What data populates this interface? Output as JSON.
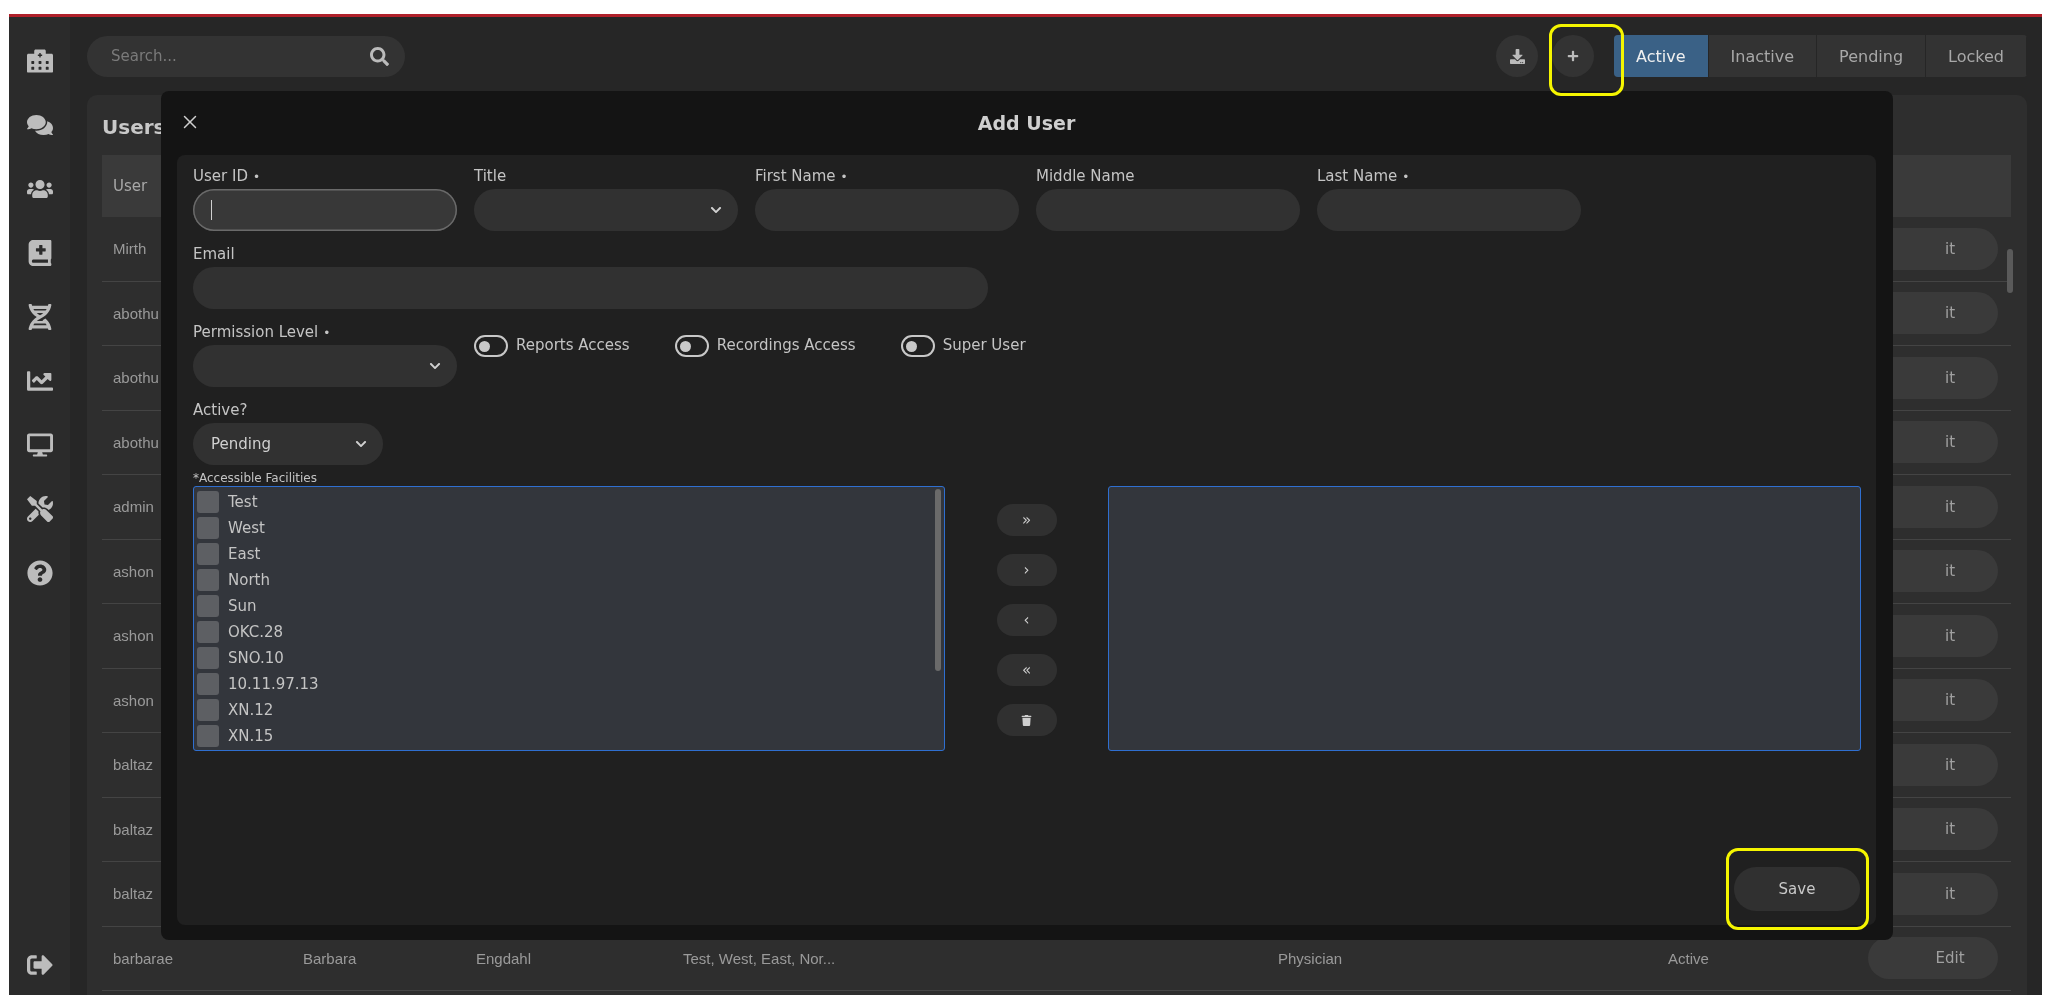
{
  "sidebar": {
    "items": [
      {
        "selected": false
      },
      {
        "selected": false
      },
      {
        "selected": false
      },
      {
        "selected": false
      },
      {
        "selected": false
      },
      {
        "selected": false
      },
      {
        "selected": false
      },
      {
        "selected": false
      },
      {
        "selected": false
      }
    ]
  },
  "topbar": {
    "search": {
      "placeholder": "Search..."
    },
    "status_tabs": [
      {
        "label": "Active",
        "selected": true
      },
      {
        "label": "Inactive",
        "selected": false
      },
      {
        "label": "Pending",
        "selected": false
      },
      {
        "label": "Locked",
        "selected": false
      }
    ]
  },
  "users_panel": {
    "title": "Users",
    "header": "User",
    "rows": [
      {
        "user": "Mirth",
        "edit": "it"
      },
      {
        "user": "abothu",
        "edit": "it"
      },
      {
        "user": "abothu",
        "edit": "it"
      },
      {
        "user": "abothu",
        "edit": "it"
      },
      {
        "user": "admin",
        "edit": "it"
      },
      {
        "user": "ashon",
        "edit": "it"
      },
      {
        "user": "ashon",
        "edit": "it"
      },
      {
        "user": "ashon",
        "edit": "it"
      },
      {
        "user": "baltaz",
        "edit": "it"
      },
      {
        "user": "baltaz",
        "edit": "it"
      },
      {
        "user": "baltaz",
        "edit": "it"
      },
      {
        "user": "barbarae",
        "first": "Barbara",
        "last": "Engdahl",
        "facilities": "Test, West, East, Nor...",
        "title": "Physician",
        "status": "Active",
        "edit": "Edit"
      }
    ]
  },
  "dialog": {
    "title": "Add User",
    "fields": [
      {
        "label": "User ID",
        "required_mark": "•",
        "kind": "text",
        "focused": true
      },
      {
        "label": "Title",
        "kind": "select"
      },
      {
        "label": "First Name",
        "required_mark": "•",
        "kind": "text",
        "focused": false
      },
      {
        "label": "Middle Name",
        "kind": "text",
        "focused": false
      },
      {
        "label": "Last Name",
        "required_mark": "•",
        "kind": "text",
        "focused": false
      }
    ],
    "email": {
      "label": "Email"
    },
    "permission": {
      "label": "Permission Level",
      "required_mark": "•"
    },
    "toggles": [
      {
        "label": "Reports Access",
        "on": false
      },
      {
        "label": "Recordings Access",
        "on": false
      },
      {
        "label": "Super User",
        "on": false
      }
    ],
    "active": {
      "label": "Active?",
      "value": "Pending"
    },
    "facilities": {
      "label": "*Accessible Facilities",
      "available": [
        {
          "name": "Test",
          "checked": false
        },
        {
          "name": "West",
          "checked": false
        },
        {
          "name": "East",
          "checked": false
        },
        {
          "name": "North",
          "checked": false
        },
        {
          "name": "Sun",
          "checked": false
        },
        {
          "name": "OKC.28",
          "checked": false
        },
        {
          "name": "SNO.10",
          "checked": false
        },
        {
          "name": "10.11.97.13",
          "checked": false
        },
        {
          "name": "XN.12",
          "checked": false
        },
        {
          "name": "XN.15",
          "checked": false
        }
      ],
      "transfer_buttons": [
        {
          "kind": "text",
          "label": "»"
        },
        {
          "kind": "text",
          "label": "›"
        },
        {
          "kind": "text",
          "label": "‹"
        },
        {
          "kind": "text",
          "label": "«"
        },
        {
          "kind": "trash"
        }
      ]
    },
    "save": "Save"
  }
}
